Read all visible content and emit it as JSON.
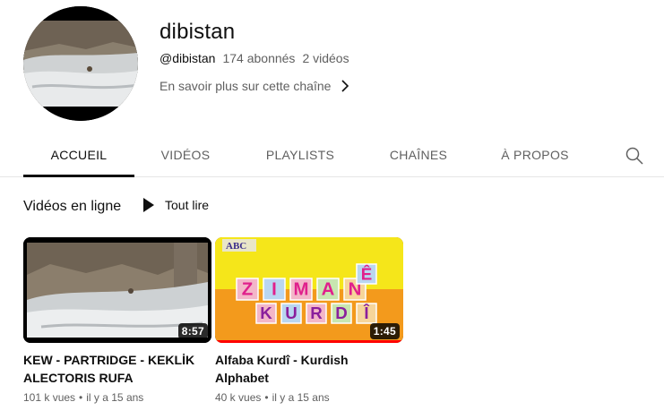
{
  "channel": {
    "name": "dibistan",
    "handle": "@dibistan",
    "subscribers": "174 abonnés",
    "video_count": "2 vidéos",
    "about_link": "En savoir plus sur cette chaîne"
  },
  "tabs": [
    {
      "label": "ACCUEIL",
      "active": true
    },
    {
      "label": "VIDÉOS",
      "active": false
    },
    {
      "label": "PLAYLISTS",
      "active": false
    },
    {
      "label": "CHAÎNES",
      "active": false
    },
    {
      "label": "À PROPOS",
      "active": false
    }
  ],
  "section": {
    "title": "Vidéos en ligne",
    "play_all": "Tout lire"
  },
  "videos": [
    {
      "title": "KEW - PARTRIDGE - KEKLİK ALECTORIS RUFA",
      "duration": "8:57",
      "views": "101 k vues",
      "age": "il y a 15 ans",
      "watched_fraction": 0
    },
    {
      "title": "Alfaba Kurdî - Kurdish Alphabet",
      "duration": "1:45",
      "views": "40 k vues",
      "age": "il y a 15 ans",
      "watched_fraction": 1.0,
      "thumb_text": {
        "corner": "ABC",
        "line1": [
          "Z",
          "I",
          "M",
          "A",
          "N"
        ],
        "accent": "Ê",
        "line2": [
          "K",
          "U",
          "R",
          "D",
          "Î"
        ]
      }
    }
  ],
  "colors": {
    "progress": "#ff0000",
    "thumb2_yellow": "#f5e61a",
    "thumb2_orange": "#f39a1c"
  },
  "icons": {
    "search": "search-icon",
    "chevron": "chevron-right-icon",
    "play": "play-icon"
  }
}
